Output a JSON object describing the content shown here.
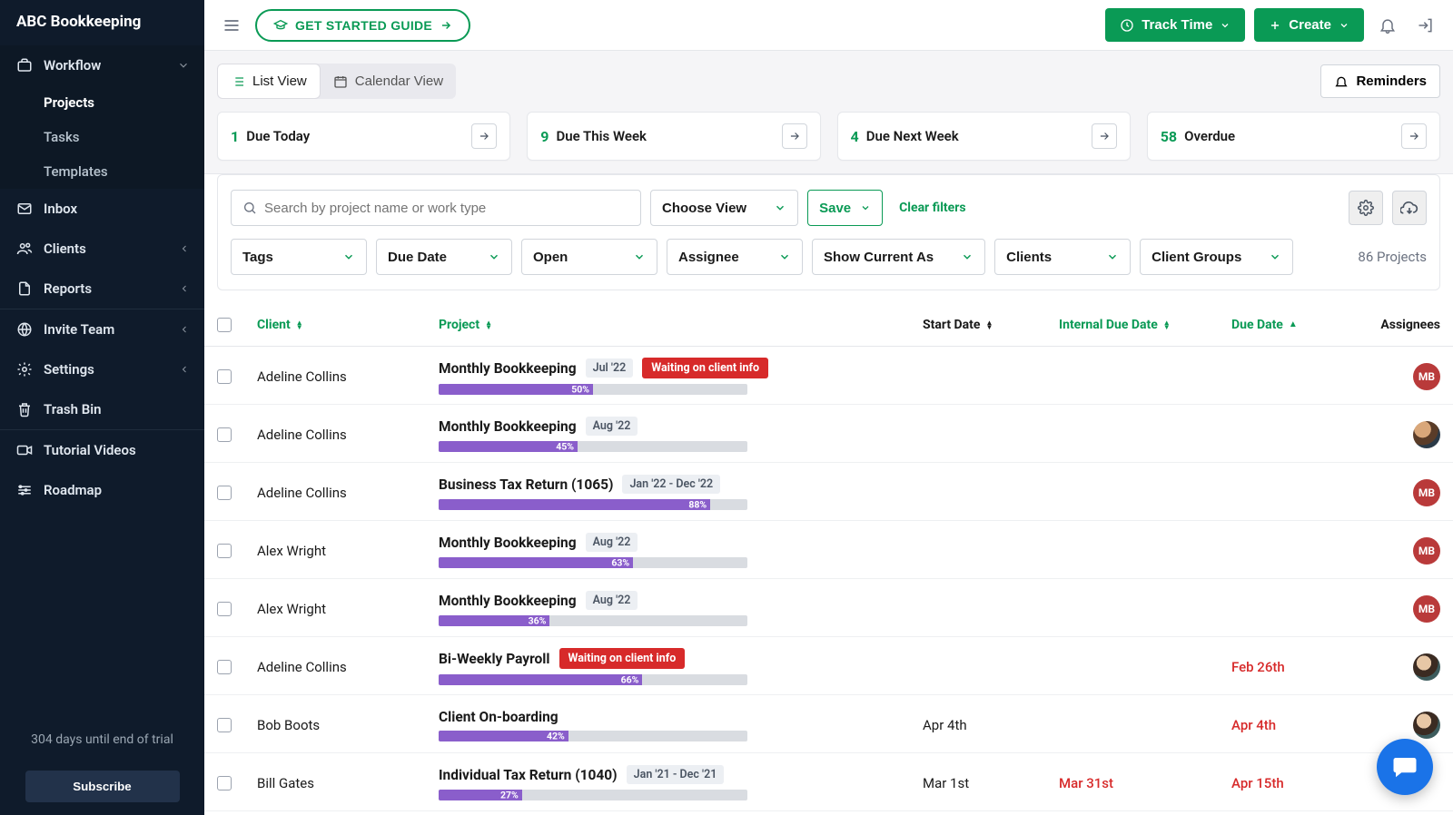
{
  "brand": "ABC Bookkeeping",
  "sidebar": {
    "workflow": {
      "label": "Workflow",
      "items": [
        "Projects",
        "Tasks",
        "Templates"
      ],
      "activeIndex": 0
    },
    "items": [
      {
        "label": "Inbox",
        "icon": "mail"
      },
      {
        "label": "Clients",
        "icon": "users",
        "chev": true
      },
      {
        "label": "Reports",
        "icon": "file",
        "chev": true
      }
    ],
    "secondary": [
      {
        "label": "Invite Team",
        "icon": "globe",
        "chev": true
      },
      {
        "label": "Settings",
        "icon": "gear",
        "chev": true
      },
      {
        "label": "Trash Bin",
        "icon": "trash"
      }
    ],
    "tertiary": [
      {
        "label": "Tutorial Videos",
        "icon": "video"
      },
      {
        "label": "Roadmap",
        "icon": "roadmap"
      }
    ],
    "trial": "304 days until end of trial",
    "subscribe": "Subscribe"
  },
  "topbar": {
    "getStarted": "GET STARTED GUIDE",
    "trackTime": "Track Time",
    "create": "Create"
  },
  "views": {
    "list": "List View",
    "calendar": "Calendar View",
    "reminders": "Reminders"
  },
  "stats": [
    {
      "count": "1",
      "label": "Due Today"
    },
    {
      "count": "9",
      "label": "Due This Week"
    },
    {
      "count": "4",
      "label": "Due Next Week"
    },
    {
      "count": "58",
      "label": "Overdue"
    }
  ],
  "search": {
    "placeholder": "Search by project name or work type"
  },
  "filterbar": {
    "chooseView": "Choose View",
    "save": "Save",
    "clear": "Clear filters",
    "filters": [
      "Tags",
      "Due Date",
      "Open",
      "Assignee",
      "Show Current As",
      "Clients",
      "Client Groups"
    ],
    "count": "86 Projects"
  },
  "columns": {
    "client": "Client",
    "project": "Project",
    "start": "Start Date",
    "internal": "Internal Due Date",
    "due": "Due Date",
    "assignees": "Assignees"
  },
  "rows": [
    {
      "client": "Adeline Collins",
      "project": "Monthly Bookkeeping",
      "period": "Jul '22",
      "status": "Waiting on client info",
      "progress": 50,
      "start": "",
      "internal": "",
      "due": "",
      "avatar": "MB"
    },
    {
      "client": "Adeline Collins",
      "project": "Monthly Bookkeeping",
      "period": "Aug '22",
      "status": "",
      "progress": 45,
      "start": "",
      "internal": "",
      "due": "",
      "avatar": "photo1"
    },
    {
      "client": "Adeline Collins",
      "project": "Business Tax Return (1065)",
      "period": "Jan '22 - Dec '22",
      "status": "",
      "progress": 88,
      "start": "",
      "internal": "",
      "due": "",
      "avatar": "MB"
    },
    {
      "client": "Alex Wright",
      "project": "Monthly Bookkeeping",
      "period": "Aug '22",
      "status": "",
      "progress": 63,
      "start": "",
      "internal": "",
      "due": "",
      "avatar": "MB"
    },
    {
      "client": "Alex Wright",
      "project": "Monthly Bookkeeping",
      "period": "Aug '22",
      "status": "",
      "progress": 36,
      "start": "",
      "internal": "",
      "due": "",
      "avatar": "MB"
    },
    {
      "client": "Adeline Collins",
      "project": "Bi-Weekly Payroll",
      "period": "",
      "status": "Waiting on client info",
      "progress": 66,
      "start": "",
      "internal": "",
      "due": "Feb 26th",
      "dueRed": true,
      "avatar": "photo2"
    },
    {
      "client": "Bob Boots",
      "project": "Client On-boarding",
      "period": "",
      "status": "",
      "progress": 42,
      "start": "Apr 4th",
      "internal": "",
      "due": "Apr 4th",
      "dueRed": true,
      "avatar": "photo2"
    },
    {
      "client": "Bill Gates",
      "project": "Individual Tax Return (1040)",
      "period": "Jan '21 - Dec '21",
      "status": "",
      "progress": 27,
      "start": "Mar 1st",
      "internal": "Mar 31st",
      "internalRed": true,
      "due": "Apr 15th",
      "dueRed": true,
      "avatar": ""
    }
  ]
}
